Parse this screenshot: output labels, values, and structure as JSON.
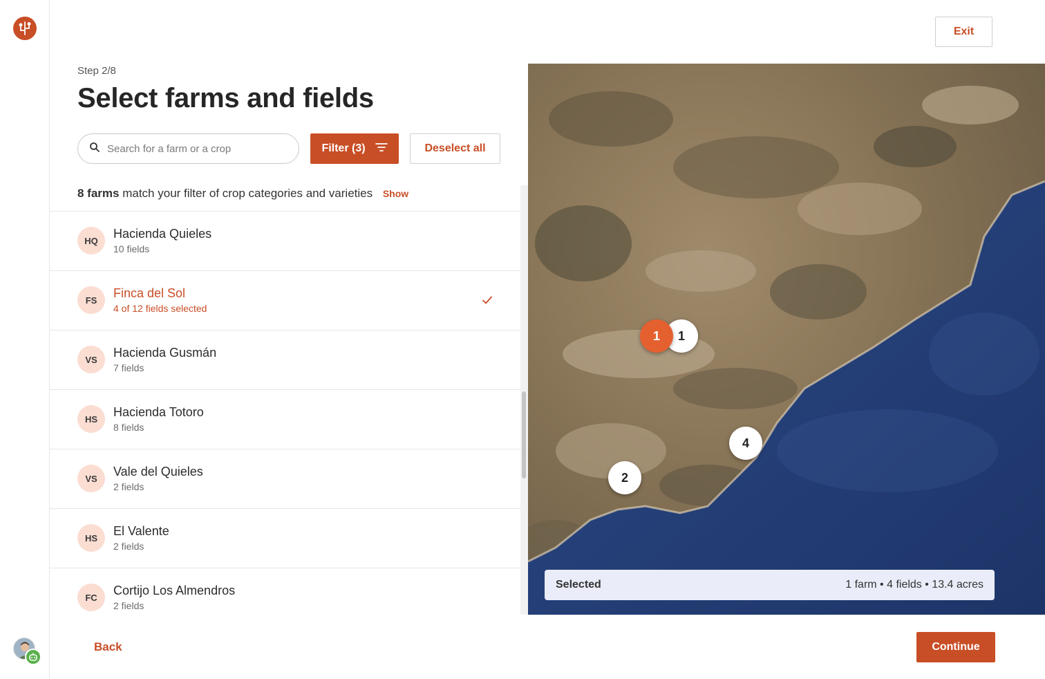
{
  "header": {
    "step": "Step 2/8",
    "title": "Select farms and fields",
    "exit_label": "Exit"
  },
  "toolbar": {
    "search_placeholder": "Search for a farm or a crop",
    "filter_label": "Filter (3)",
    "deselect_label": "Deselect all"
  },
  "summary": {
    "count": "8 farms",
    "text": "match your filter of crop categories and varieties",
    "show_label": "Show"
  },
  "farms": [
    {
      "initials": "HQ",
      "name": "Hacienda Quieles",
      "sub": "10 fields",
      "selected": false
    },
    {
      "initials": "FS",
      "name": "Finca del Sol",
      "sub": "4 of 12 fields selected",
      "selected": true
    },
    {
      "initials": "VS",
      "name": "Hacienda Gusmán",
      "sub": "7 fields",
      "selected": false
    },
    {
      "initials": "HS",
      "name": "Hacienda Totoro",
      "sub": "8 fields",
      "selected": false
    },
    {
      "initials": "VS",
      "name": "Vale del Quieles",
      "sub": "2 fields",
      "selected": false
    },
    {
      "initials": "HS",
      "name": "El Valente",
      "sub": "2 fields",
      "selected": false
    },
    {
      "initials": "FC",
      "name": "Cortijo Los Almendros",
      "sub": "2 fields",
      "selected": false
    }
  ],
  "map": {
    "pins": [
      {
        "label": "1",
        "active": true
      },
      {
        "label": "1",
        "active": false
      },
      {
        "label": "4",
        "active": false
      },
      {
        "label": "2",
        "active": false
      }
    ],
    "selected_label": "Selected",
    "selected_summary": "1 farm • 4 fields • 13.4 acres"
  },
  "footer": {
    "back_label": "Back",
    "continue_label": "Continue"
  },
  "colors": {
    "accent": "#c84e26",
    "avatar_bg": "#fbddd2",
    "selected_bar_bg": "#eaedf9",
    "pin_active": "#e5602f"
  }
}
